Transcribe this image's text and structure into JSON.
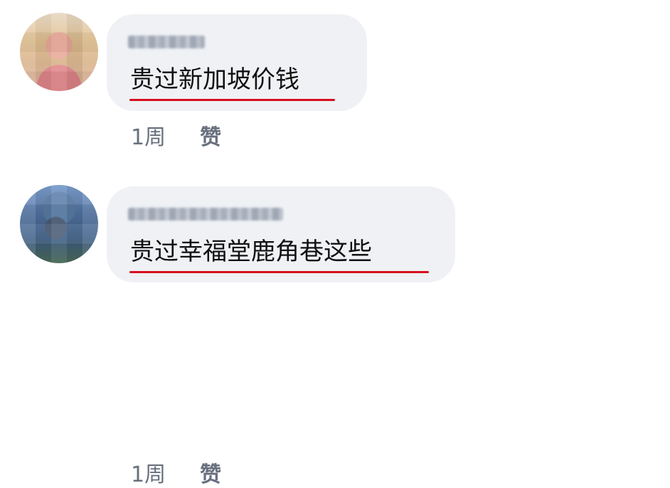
{
  "comments": [
    {
      "text": "贵过新加坡价钱",
      "time": "1周",
      "like_label": "赞"
    },
    {
      "text": "贵过幸福堂鹿角巷这些",
      "time": "1周",
      "like_label": "赞"
    }
  ],
  "colors": {
    "bubble": "#eff1f4",
    "meta_text": "#68707d",
    "underline": "#d70f1f"
  }
}
